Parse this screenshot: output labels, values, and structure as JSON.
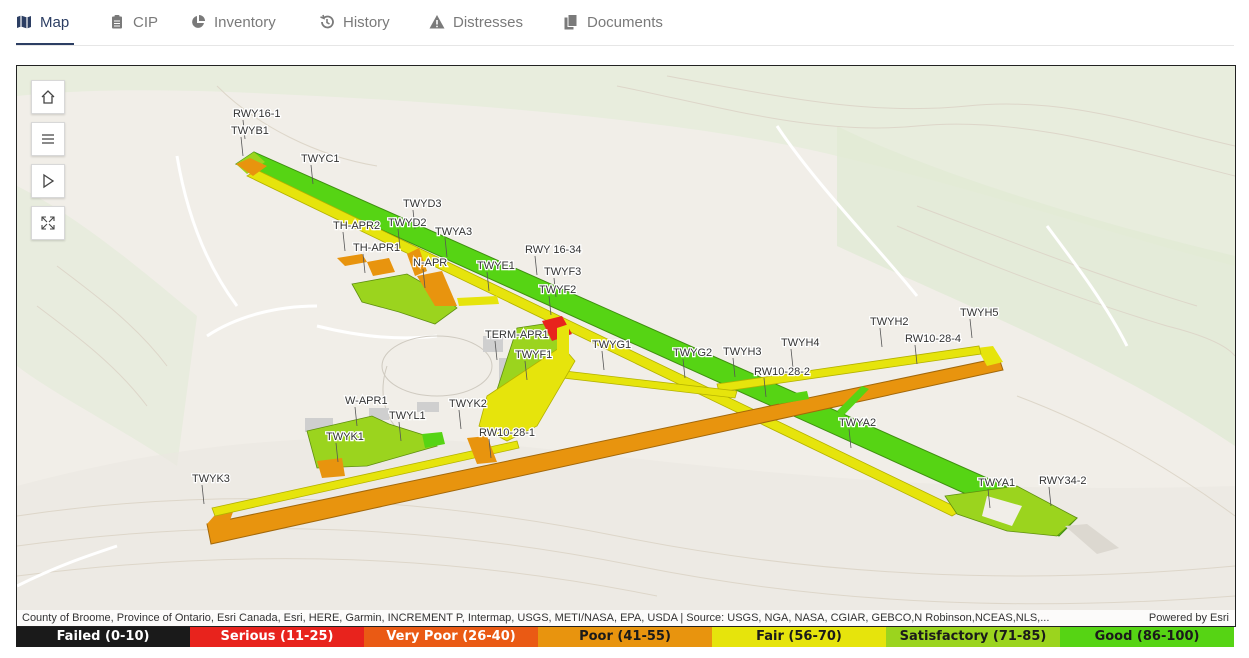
{
  "tabs": [
    {
      "label": "Map",
      "icon": "map-icon",
      "active": true
    },
    {
      "label": "CIP",
      "icon": "clipboard-icon",
      "active": false
    },
    {
      "label": "Inventory",
      "icon": "pie-chart-icon",
      "active": false
    },
    {
      "label": "History",
      "icon": "history-icon",
      "active": false
    },
    {
      "label": "Distresses",
      "icon": "warning-icon",
      "active": false
    },
    {
      "label": "Documents",
      "icon": "documents-icon",
      "active": false
    }
  ],
  "map": {
    "controls": [
      "home-icon",
      "list-icon",
      "play-icon",
      "expand-icon"
    ],
    "labels": [
      "RWY16-1",
      "TWYB1",
      "TWYC1",
      "TWYD3",
      "TH-APR2",
      "TWYD2",
      "TWYA3",
      "TH-APR1",
      "N-APR",
      "TWYE1",
      "RWY 16-34",
      "TWYF3",
      "TWYF2",
      "TERM-APR1",
      "TWYF1",
      "TWYG1",
      "TWYG2",
      "TWYH3",
      "TWYH4",
      "RW10-28-2",
      "TWYH2",
      "RW10-28-4",
      "TWYH5",
      "W-APR1",
      "TWYL1",
      "TWYK2",
      "TWYK1",
      "RW10-28-1",
      "TWYA2",
      "TWYK3",
      "TWYA1",
      "RWY34-2"
    ],
    "attribution": "County of Broome, Province of Ontario, Esri Canada, Esri, HERE, Garmin, INCREMENT P, Intermap, USGS, METI/NASA, EPA, USDA | Source: USGS, NGA, NASA, CGIAR, GEBCO,N Robinson,NCEAS,NLS,...",
    "powered_by": "Powered by Esri"
  },
  "legend": [
    {
      "label": "Failed (0-10)",
      "color": "#1a1a1a",
      "text_color": "#ffffff"
    },
    {
      "label": "Serious (11-25)",
      "color": "#e8231d",
      "text_color": "#ffffff"
    },
    {
      "label": "Very Poor (26-40)",
      "color": "#ea5a14",
      "text_color": "#ffffff"
    },
    {
      "label": "Poor (41-55)",
      "color": "#e8940e",
      "text_color": "#1a1a1a"
    },
    {
      "label": "Fair (56-70)",
      "color": "#e6e40c",
      "text_color": "#1a1a1a"
    },
    {
      "label": "Satisfactory (71-85)",
      "color": "#9bd41e",
      "text_color": "#1a1a1a"
    },
    {
      "label": "Good (86-100)",
      "color": "#56d414",
      "text_color": "#1a1a1a"
    }
  ]
}
